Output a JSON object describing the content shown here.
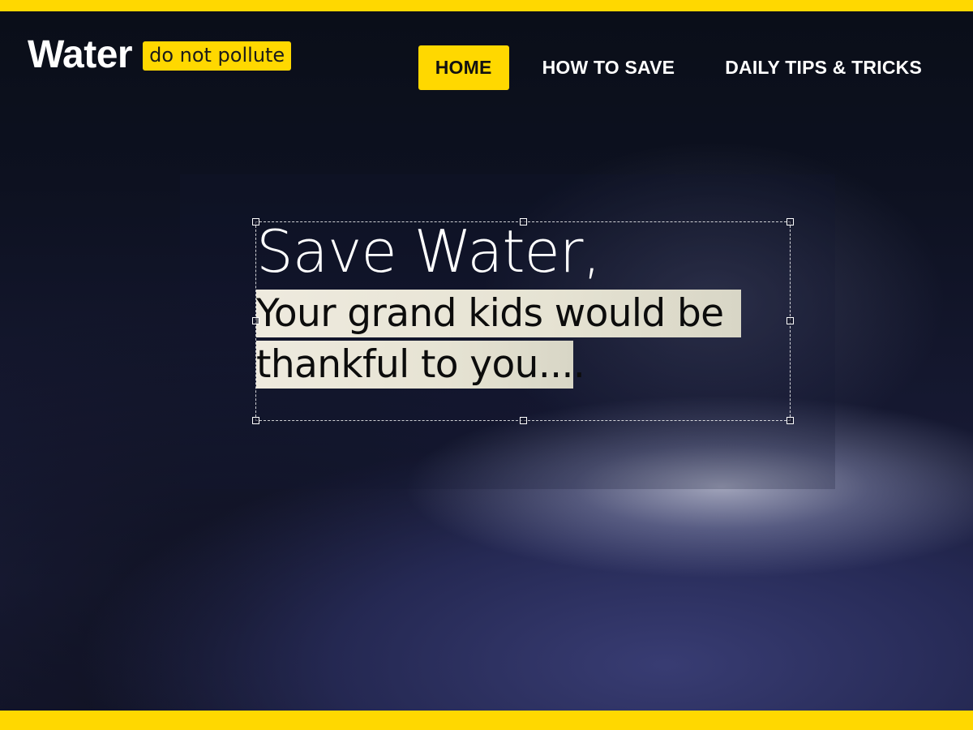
{
  "colors": {
    "accent": "#ffd800",
    "background": "#0a0d18",
    "text": "#ffffff"
  },
  "logo": {
    "title": "Water",
    "tagline": "do not pollute"
  },
  "nav": {
    "items": [
      {
        "label": "HOME",
        "active": true
      },
      {
        "label": "HOW TO SAVE",
        "active": false
      },
      {
        "label": "DAILY TIPS & TRICKS",
        "active": false
      }
    ]
  },
  "hero": {
    "headline": "Save Water,",
    "subline_1": "Your grand kids would be",
    "subline_2": "thankful to you...."
  }
}
